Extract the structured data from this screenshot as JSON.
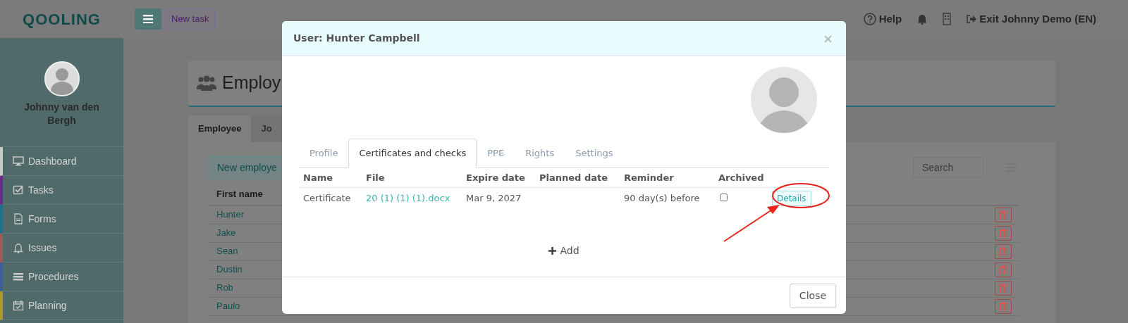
{
  "app": {
    "logo": "QOOLING",
    "new_task": "New task",
    "help": "Help",
    "exit": "Exit Johnny Demo (EN)"
  },
  "sidebar": {
    "user_name": "Johnny van den Bergh",
    "items": [
      {
        "label": "Dashboard",
        "color": "#c8c8c8"
      },
      {
        "label": "Tasks",
        "color": "#6a2a86"
      },
      {
        "label": "Forms",
        "color": "#1f6f8f"
      },
      {
        "label": "Issues",
        "color": "#a05858"
      },
      {
        "label": "Procedures",
        "color": "#3f5f92"
      },
      {
        "label": "Planning",
        "color": "#a89a24"
      }
    ]
  },
  "page": {
    "title": "Employ",
    "tabs": [
      {
        "label": "Employee",
        "selected": true
      },
      {
        "label": "Jo",
        "selected": false
      }
    ],
    "new_button": "New employe",
    "search": {
      "placeholder": "Search"
    },
    "column": "First name",
    "rows": [
      "Hunter",
      "Jake",
      "Sean",
      "Dustin",
      "Rob",
      "Paulo"
    ]
  },
  "modal": {
    "title": "User: Hunter Campbell",
    "tabs": [
      {
        "label": "Profile",
        "selected": false
      },
      {
        "label": "Certificates and checks",
        "selected": true
      },
      {
        "label": "PPE",
        "selected": false
      },
      {
        "label": "Rights",
        "selected": false
      },
      {
        "label": "Settings",
        "selected": false
      }
    ],
    "columns": [
      "Name",
      "File",
      "Expire date",
      "Planned date",
      "Reminder",
      "Archived"
    ],
    "rows": [
      {
        "name": "Certificate",
        "file": "20 (1) (1) (1).docx",
        "expire_date": "Mar 9, 2027",
        "reminder": "90 day(s) before",
        "archived": false,
        "action": "Details"
      }
    ],
    "add": "Add",
    "close": "Close"
  }
}
